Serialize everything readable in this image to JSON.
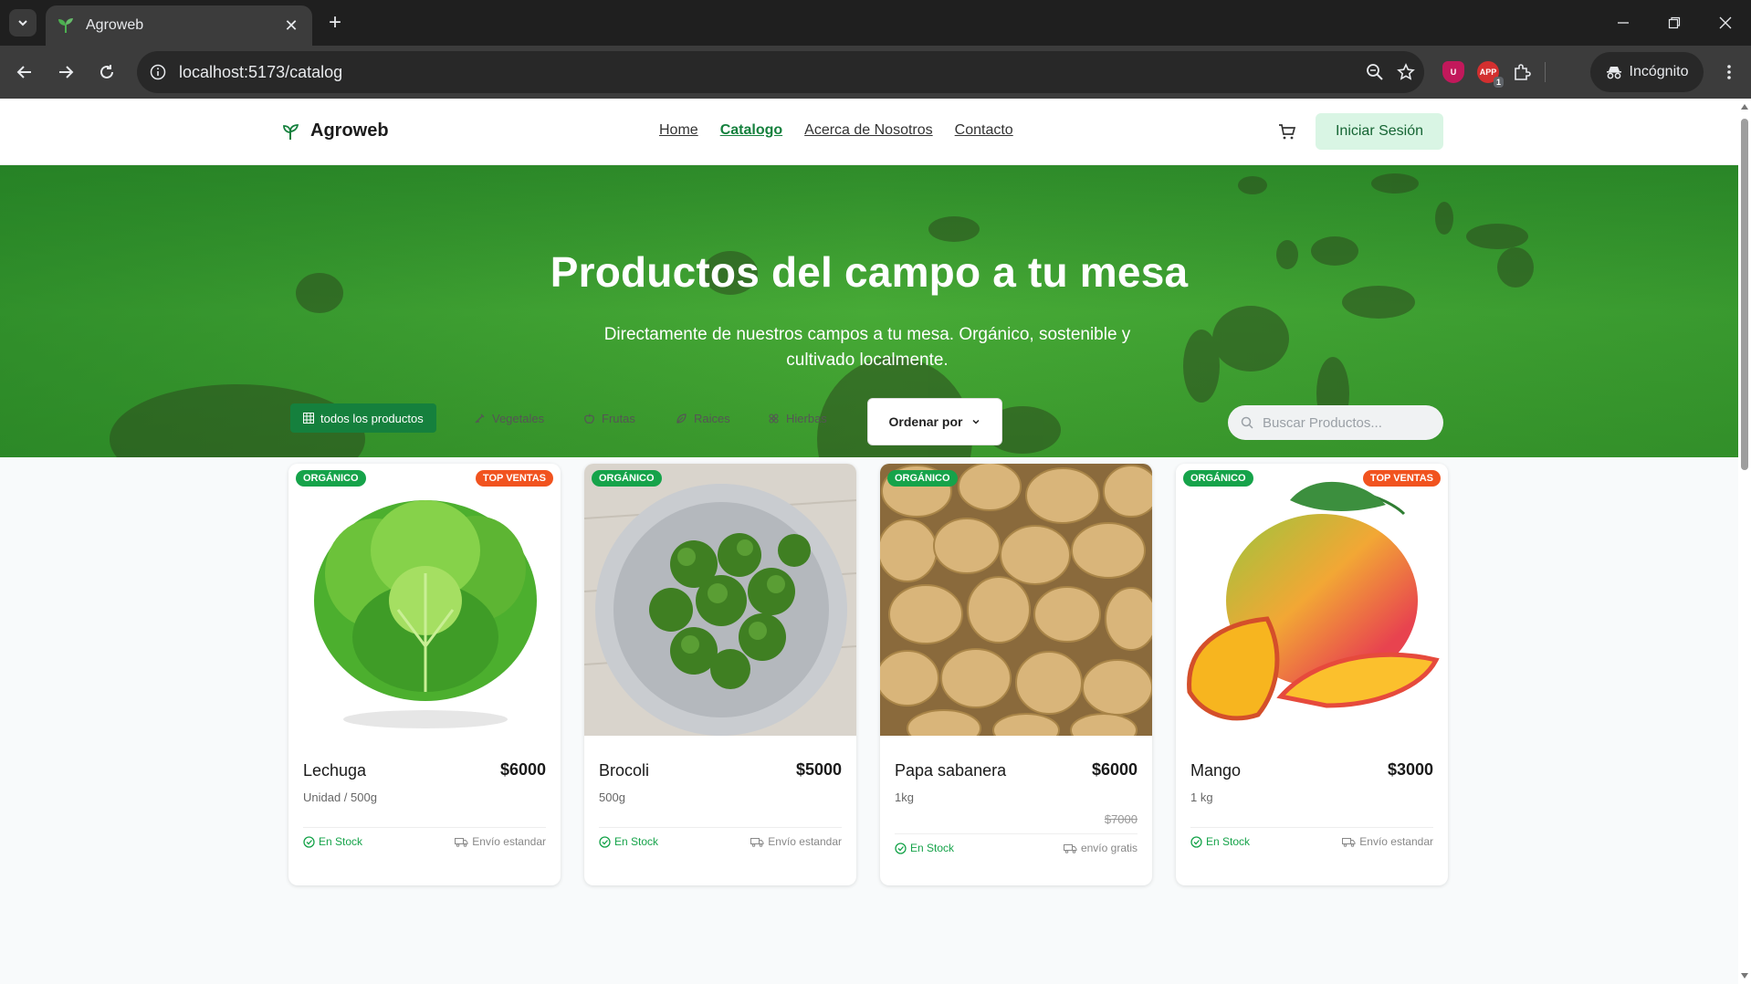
{
  "browser": {
    "tab_title": "Agroweb",
    "url": "localhost:5173/catalog",
    "incognito_label": "Incógnito",
    "ext_label": "APP",
    "ext_count": "1"
  },
  "header": {
    "brand": "Agroweb",
    "nav": [
      "Home",
      "Catalogo",
      "Acerca de Nosotros",
      "Contacto"
    ],
    "active_nav": "Catalogo",
    "login_label": "Iniciar Sesión"
  },
  "hero": {
    "title": "Productos del campo a tu mesa",
    "subtitle": "Directamente de nuestros campos a tu mesa. Orgánico, sostenible y cultivado localmente."
  },
  "filters": {
    "chips": [
      "todos los productos",
      "Vegetales",
      "Frutas",
      "Raices",
      "Hierbas"
    ],
    "active_chip": "todos los productos",
    "sort_label": "Ordenar por",
    "search_placeholder": "Buscar Productos..."
  },
  "products": [
    {
      "name": "Lechuga",
      "price": "$6000",
      "old_price": "",
      "unit": "Unidad / 500g",
      "badge_left": "ORGÁNICO",
      "badge_right": "TOP VENTAS",
      "stock": "En Stock",
      "shipping": "Envío estandar"
    },
    {
      "name": "Brocoli",
      "price": "$5000",
      "old_price": "",
      "unit": "500g",
      "badge_left": "ORGÁNICO",
      "badge_right": "",
      "stock": "En Stock",
      "shipping": "Envío estandar"
    },
    {
      "name": "Papa sabanera",
      "price": "$6000",
      "old_price": "$7000",
      "unit": "1kg",
      "badge_left": "ORGÁNICO",
      "badge_right": "",
      "stock": "En Stock",
      "shipping": "envío gratis"
    },
    {
      "name": "Mango",
      "price": "$3000",
      "old_price": "",
      "unit": "1 kg",
      "badge_left": "ORGÁNICO",
      "badge_right": "TOP VENTAS",
      "stock": "En Stock",
      "shipping": "Envío estandar"
    }
  ],
  "colors": {
    "brand_green": "#15803d",
    "stock_green": "#16a34a",
    "top_sales_orange": "#f1531f",
    "login_bg": "#d9f5e4"
  }
}
